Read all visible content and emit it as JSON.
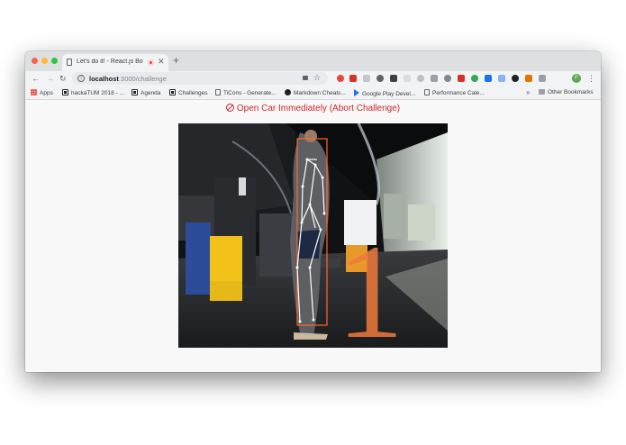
{
  "browser": {
    "tab": {
      "title": "Let's do it! - React.js Boiler"
    },
    "address": {
      "host": "localhost",
      "path": ":3000/challenge"
    },
    "bookmarks": [
      {
        "label": "Apps",
        "icon": "apps-icon"
      },
      {
        "label": "hackaTUM 2018 - ...",
        "icon": "notion-icon"
      },
      {
        "label": "Agenda",
        "icon": "notion-icon"
      },
      {
        "label": "Challenges",
        "icon": "notion-icon"
      },
      {
        "label": "TiCons - Generate...",
        "icon": "document-icon"
      },
      {
        "label": "Markdown Cheats...",
        "icon": "github-icon"
      },
      {
        "label": "Google Play Devel...",
        "icon": "google-play-icon"
      },
      {
        "label": "Performance Cale...",
        "icon": "document-icon"
      }
    ],
    "other_bookmarks": "Other Bookmarks",
    "more_glyph": "»",
    "profile_initial": "F"
  },
  "page": {
    "abort_link": "Open Car Immediately (Abort Challenge)",
    "countdown": "1",
    "colors": {
      "abort": "#d0232c",
      "countdown": "#f07a3b",
      "skeleton": "#ffffff",
      "bounding_box": "#ff6a2a"
    }
  }
}
